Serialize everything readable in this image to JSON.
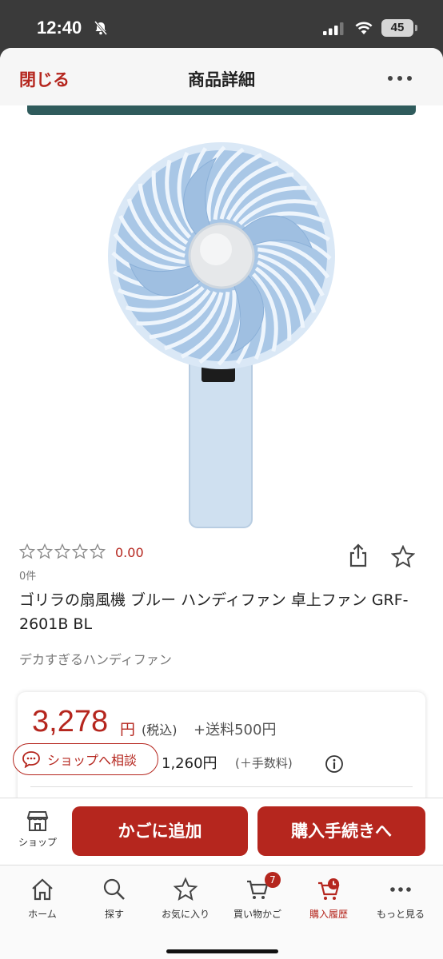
{
  "status_bar": {
    "time": "12:40",
    "battery": "45"
  },
  "nav": {
    "close_label": "閉じる",
    "title": "商品詳細"
  },
  "product": {
    "rating_score": "0.00",
    "review_count": "0件",
    "name": "ゴリラの扇風機 ブルー ハンディファン 卓上ファン GRF-2601B BL",
    "catch_copy": "デカすぎるハンディファン",
    "image_alt": "blue-handheld-fan"
  },
  "price": {
    "amount": "3,278",
    "unit": "円",
    "tax_note": "(税込)",
    "shipping": "+送料500円",
    "installment": "1,260円",
    "installment_fee": "(＋手数料)"
  },
  "consult": {
    "label": "ショップへ相談"
  },
  "actions": {
    "shop_label": "ショップ",
    "cart_label": "かごに追加",
    "buy_label": "購入手続きへ"
  },
  "tabs": [
    {
      "label": "ホーム",
      "icon": "home-icon"
    },
    {
      "label": "探す",
      "icon": "search-icon"
    },
    {
      "label": "お気に入り",
      "icon": "star-icon"
    },
    {
      "label": "買い物かご",
      "icon": "cart-icon",
      "badge": "7"
    },
    {
      "label": "購入履歴",
      "icon": "history-icon",
      "active": true
    },
    {
      "label": "もっと見る",
      "icon": "more-icon"
    }
  ],
  "colors": {
    "accent": "#b5261e",
    "fan_blue": "#b6cfe8",
    "teal_banner": "#2f5b5c"
  }
}
